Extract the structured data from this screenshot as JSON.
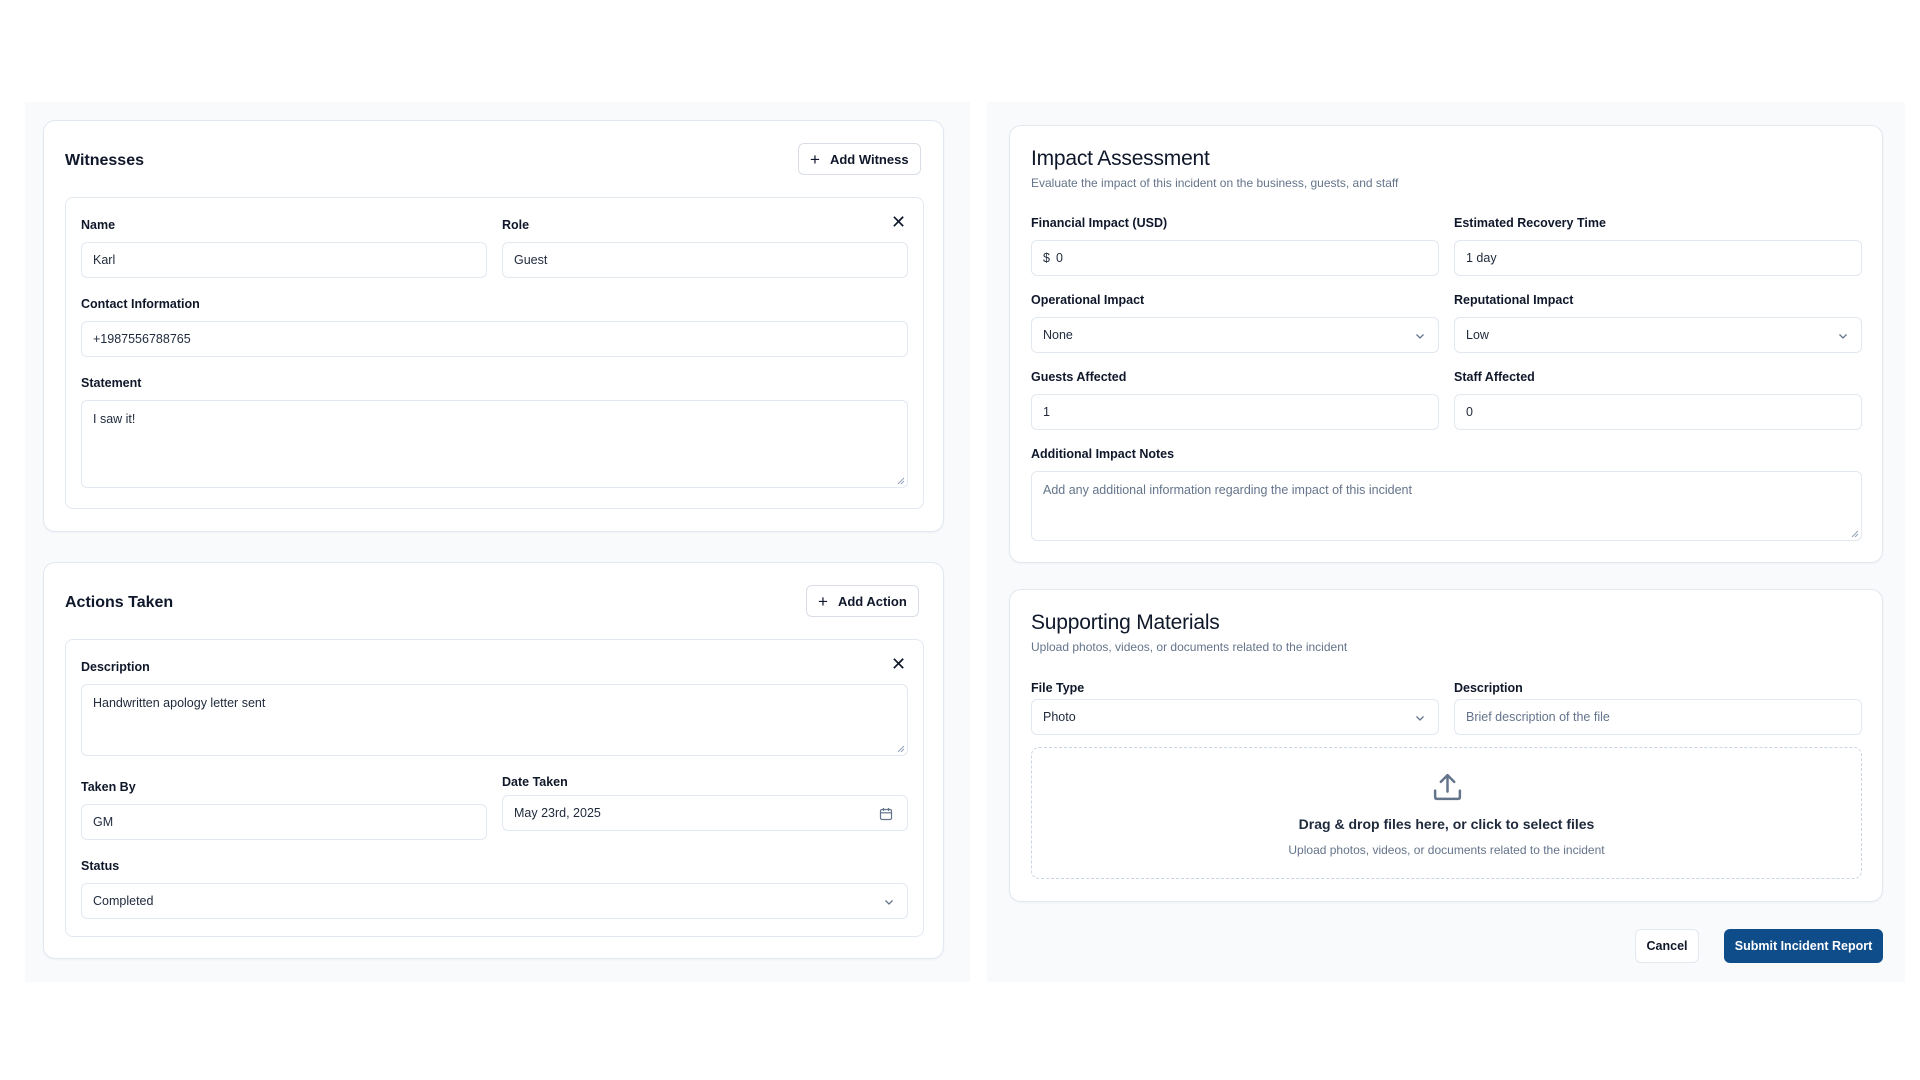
{
  "witnesses": {
    "title": "Witnesses",
    "add_label": "Add Witness",
    "name_label": "Name",
    "name_value": "Karl",
    "role_label": "Role",
    "role_value": "Guest",
    "contact_label": "Contact Information",
    "contact_value": "+1987556788765",
    "statement_label": "Statement",
    "statement_value": "I saw it!"
  },
  "actions": {
    "title": "Actions Taken",
    "add_label": "Add Action",
    "description_label": "Description",
    "description_value": "Handwritten apology letter sent",
    "taken_by_label": "Taken By",
    "taken_by_value": "GM",
    "date_label": "Date Taken",
    "date_value": "May 23rd, 2025",
    "status_label": "Status",
    "status_value": "Completed"
  },
  "impact": {
    "title": "Impact Assessment",
    "description": "Evaluate the impact of this incident on the business, guests, and staff",
    "financial_label": "Financial Impact (USD)",
    "currency_symbol": "$",
    "financial_value": "0",
    "recovery_label": "Estimated Recovery Time",
    "recovery_value": "1 day",
    "operational_label": "Operational Impact",
    "operational_value": "None",
    "reputational_label": "Reputational Impact",
    "reputational_value": "Low",
    "guests_label": "Guests Affected",
    "guests_value": "1",
    "staff_label": "Staff Affected",
    "staff_value": "0",
    "notes_label": "Additional Impact Notes",
    "notes_placeholder": "Add any additional information regarding the impact of this incident"
  },
  "supporting": {
    "title": "Supporting Materials",
    "description": "Upload photos, videos, or documents related to the incident",
    "file_type_label": "File Type",
    "file_type_value": "Photo",
    "desc_label": "Description",
    "desc_placeholder": "Brief description of the file",
    "dropzone_title": "Drag & drop files here, or click to select files",
    "dropzone_subtitle": "Upload photos, videos, or documents related to the incident"
  },
  "footer": {
    "cancel_label": "Cancel",
    "submit_label": "Submit Incident Report"
  },
  "colors": {
    "primary": "#0f4c8a",
    "border": "#e2e8f0",
    "muted_text": "#64748b",
    "panel_bg": "#f8fafc"
  },
  "icons": [
    "plus-icon",
    "close-icon",
    "chevron-down-icon",
    "calendar-icon",
    "upload-icon",
    "resize-handle-icon"
  ]
}
